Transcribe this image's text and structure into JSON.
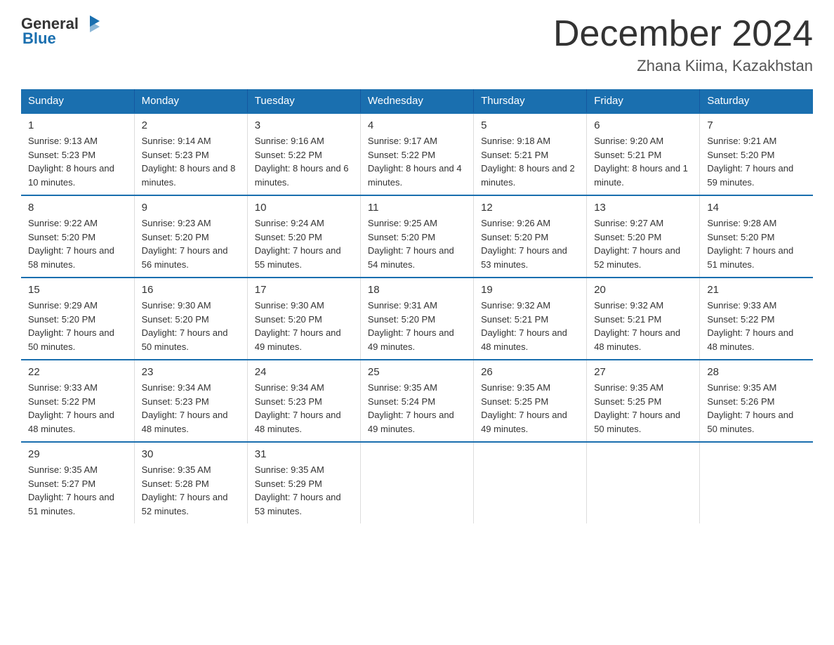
{
  "header": {
    "logo_general": "General",
    "logo_blue": "Blue",
    "month_year": "December 2024",
    "location": "Zhana Kiima, Kazakhstan"
  },
  "weekdays": [
    "Sunday",
    "Monday",
    "Tuesday",
    "Wednesday",
    "Thursday",
    "Friday",
    "Saturday"
  ],
  "weeks": [
    [
      {
        "day": "1",
        "sunrise": "9:13 AM",
        "sunset": "5:23 PM",
        "daylight": "8 hours and 10 minutes."
      },
      {
        "day": "2",
        "sunrise": "9:14 AM",
        "sunset": "5:23 PM",
        "daylight": "8 hours and 8 minutes."
      },
      {
        "day": "3",
        "sunrise": "9:16 AM",
        "sunset": "5:22 PM",
        "daylight": "8 hours and 6 minutes."
      },
      {
        "day": "4",
        "sunrise": "9:17 AM",
        "sunset": "5:22 PM",
        "daylight": "8 hours and 4 minutes."
      },
      {
        "day": "5",
        "sunrise": "9:18 AM",
        "sunset": "5:21 PM",
        "daylight": "8 hours and 2 minutes."
      },
      {
        "day": "6",
        "sunrise": "9:20 AM",
        "sunset": "5:21 PM",
        "daylight": "8 hours and 1 minute."
      },
      {
        "day": "7",
        "sunrise": "9:21 AM",
        "sunset": "5:20 PM",
        "daylight": "7 hours and 59 minutes."
      }
    ],
    [
      {
        "day": "8",
        "sunrise": "9:22 AM",
        "sunset": "5:20 PM",
        "daylight": "7 hours and 58 minutes."
      },
      {
        "day": "9",
        "sunrise": "9:23 AM",
        "sunset": "5:20 PM",
        "daylight": "7 hours and 56 minutes."
      },
      {
        "day": "10",
        "sunrise": "9:24 AM",
        "sunset": "5:20 PM",
        "daylight": "7 hours and 55 minutes."
      },
      {
        "day": "11",
        "sunrise": "9:25 AM",
        "sunset": "5:20 PM",
        "daylight": "7 hours and 54 minutes."
      },
      {
        "day": "12",
        "sunrise": "9:26 AM",
        "sunset": "5:20 PM",
        "daylight": "7 hours and 53 minutes."
      },
      {
        "day": "13",
        "sunrise": "9:27 AM",
        "sunset": "5:20 PM",
        "daylight": "7 hours and 52 minutes."
      },
      {
        "day": "14",
        "sunrise": "9:28 AM",
        "sunset": "5:20 PM",
        "daylight": "7 hours and 51 minutes."
      }
    ],
    [
      {
        "day": "15",
        "sunrise": "9:29 AM",
        "sunset": "5:20 PM",
        "daylight": "7 hours and 50 minutes."
      },
      {
        "day": "16",
        "sunrise": "9:30 AM",
        "sunset": "5:20 PM",
        "daylight": "7 hours and 50 minutes."
      },
      {
        "day": "17",
        "sunrise": "9:30 AM",
        "sunset": "5:20 PM",
        "daylight": "7 hours and 49 minutes."
      },
      {
        "day": "18",
        "sunrise": "9:31 AM",
        "sunset": "5:20 PM",
        "daylight": "7 hours and 49 minutes."
      },
      {
        "day": "19",
        "sunrise": "9:32 AM",
        "sunset": "5:21 PM",
        "daylight": "7 hours and 48 minutes."
      },
      {
        "day": "20",
        "sunrise": "9:32 AM",
        "sunset": "5:21 PM",
        "daylight": "7 hours and 48 minutes."
      },
      {
        "day": "21",
        "sunrise": "9:33 AM",
        "sunset": "5:22 PM",
        "daylight": "7 hours and 48 minutes."
      }
    ],
    [
      {
        "day": "22",
        "sunrise": "9:33 AM",
        "sunset": "5:22 PM",
        "daylight": "7 hours and 48 minutes."
      },
      {
        "day": "23",
        "sunrise": "9:34 AM",
        "sunset": "5:23 PM",
        "daylight": "7 hours and 48 minutes."
      },
      {
        "day": "24",
        "sunrise": "9:34 AM",
        "sunset": "5:23 PM",
        "daylight": "7 hours and 48 minutes."
      },
      {
        "day": "25",
        "sunrise": "9:35 AM",
        "sunset": "5:24 PM",
        "daylight": "7 hours and 49 minutes."
      },
      {
        "day": "26",
        "sunrise": "9:35 AM",
        "sunset": "5:25 PM",
        "daylight": "7 hours and 49 minutes."
      },
      {
        "day": "27",
        "sunrise": "9:35 AM",
        "sunset": "5:25 PM",
        "daylight": "7 hours and 50 minutes."
      },
      {
        "day": "28",
        "sunrise": "9:35 AM",
        "sunset": "5:26 PM",
        "daylight": "7 hours and 50 minutes."
      }
    ],
    [
      {
        "day": "29",
        "sunrise": "9:35 AM",
        "sunset": "5:27 PM",
        "daylight": "7 hours and 51 minutes."
      },
      {
        "day": "30",
        "sunrise": "9:35 AM",
        "sunset": "5:28 PM",
        "daylight": "7 hours and 52 minutes."
      },
      {
        "day": "31",
        "sunrise": "9:35 AM",
        "sunset": "5:29 PM",
        "daylight": "7 hours and 53 minutes."
      },
      null,
      null,
      null,
      null
    ]
  ]
}
